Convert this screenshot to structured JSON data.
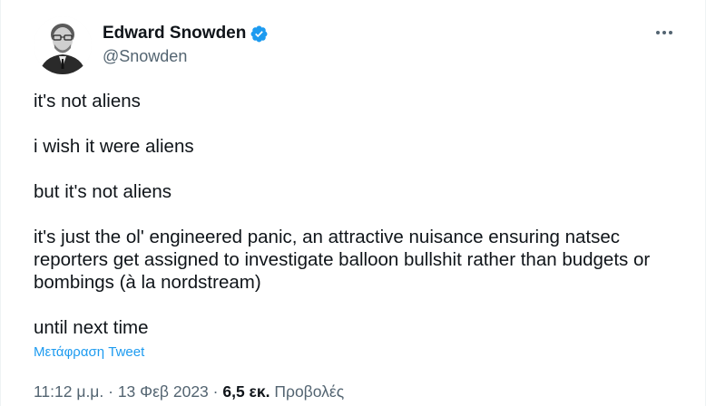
{
  "author": {
    "display_name": "Edward Snowden",
    "handle": "@Snowden",
    "verified_icon": "verified-badge-icon",
    "accent_color": "#1d9bf0"
  },
  "more_icon": "more-options-icon",
  "tweet": {
    "paragraphs": [
      "it's not aliens",
      "i wish it were aliens",
      "but it's not aliens",
      "it's just the ol' engineered panic, an attractive nuisance ensuring natsec reporters get assigned to investigate balloon bullshit rather than budgets or bombings (à la nordstream)",
      "until next time"
    ]
  },
  "translate_label": "Μετάφραση Tweet",
  "meta": {
    "time": "11:12 μ.μ.",
    "separator": "·",
    "date": "13 Φεβ 2023",
    "views_count": "6,5 εκ.",
    "views_label": "Προβολές"
  }
}
